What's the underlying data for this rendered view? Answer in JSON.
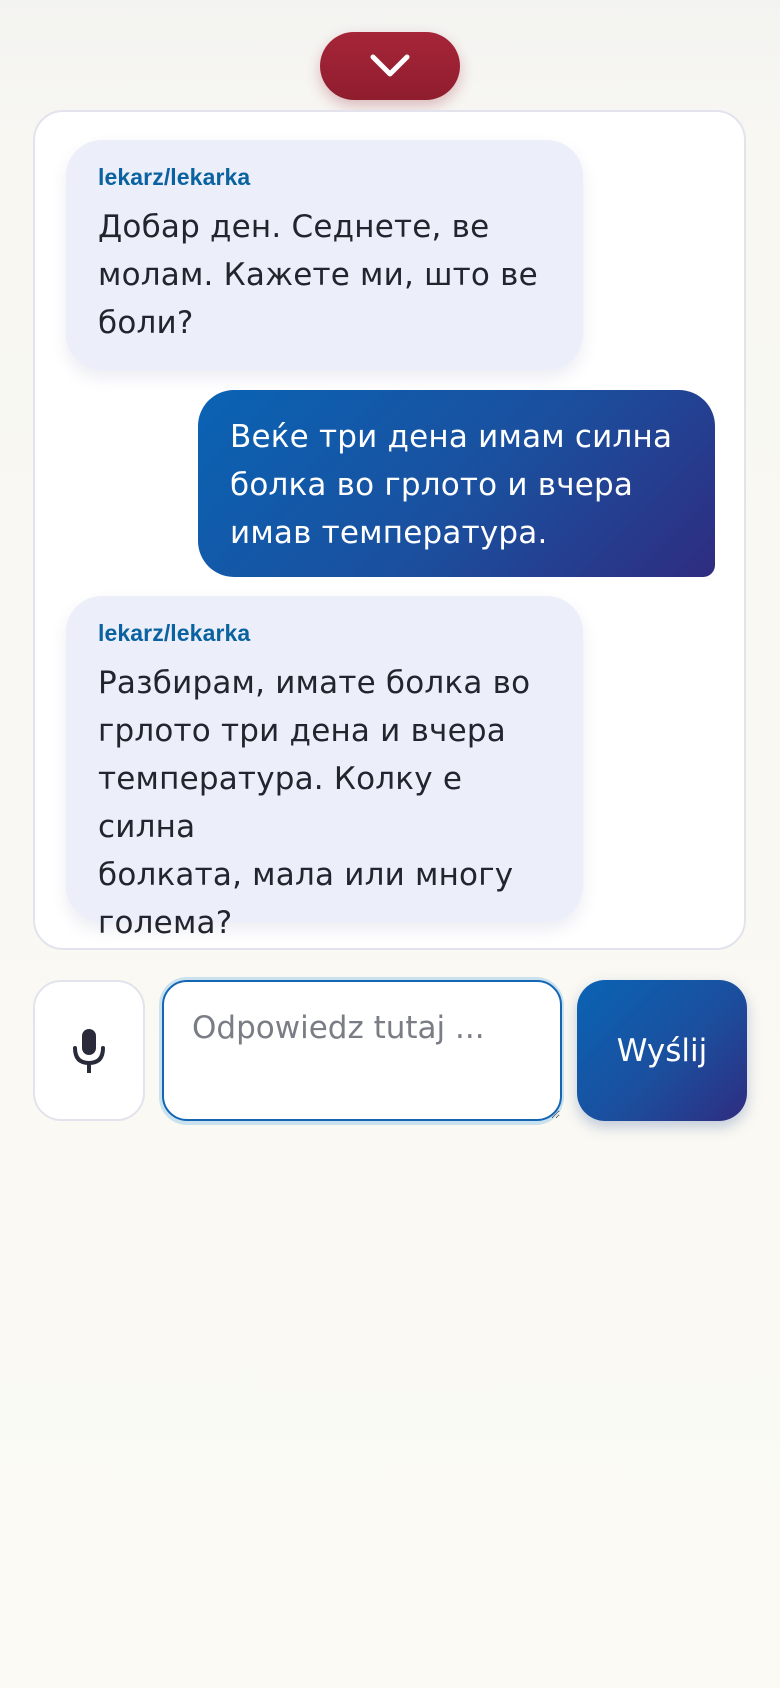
{
  "header": {
    "collapse_icon": "chevron-down-icon",
    "collapse_color": "#9a2133"
  },
  "messages": [
    {
      "role": "doctor",
      "sender": "lekarz/lekarka",
      "text": "Добар ден. Седнете, ве\nмолам. Кажете ми, што ве\nболи?"
    },
    {
      "role": "patient",
      "text": "Веќе три дена имам силна\nболка во грлото и вчера\nимав температура."
    },
    {
      "role": "doctor",
      "sender": "lekarz/lekarka",
      "text": "Разбирам, имате болка во\nгрлото три дена и вчера\nтемпература. Колку е силна\nболката, мала или многу\nголема?"
    }
  ],
  "composer": {
    "mic_icon": "microphone-icon",
    "placeholder": "Odpowiedz tutaj ...",
    "value": "",
    "send_label": "Wyślij"
  },
  "colors": {
    "accent": "#0a63b4",
    "accent_dark": "#2f2c80",
    "sender_label": "#0a62a0",
    "doctor_bubble": "#eceff9"
  }
}
